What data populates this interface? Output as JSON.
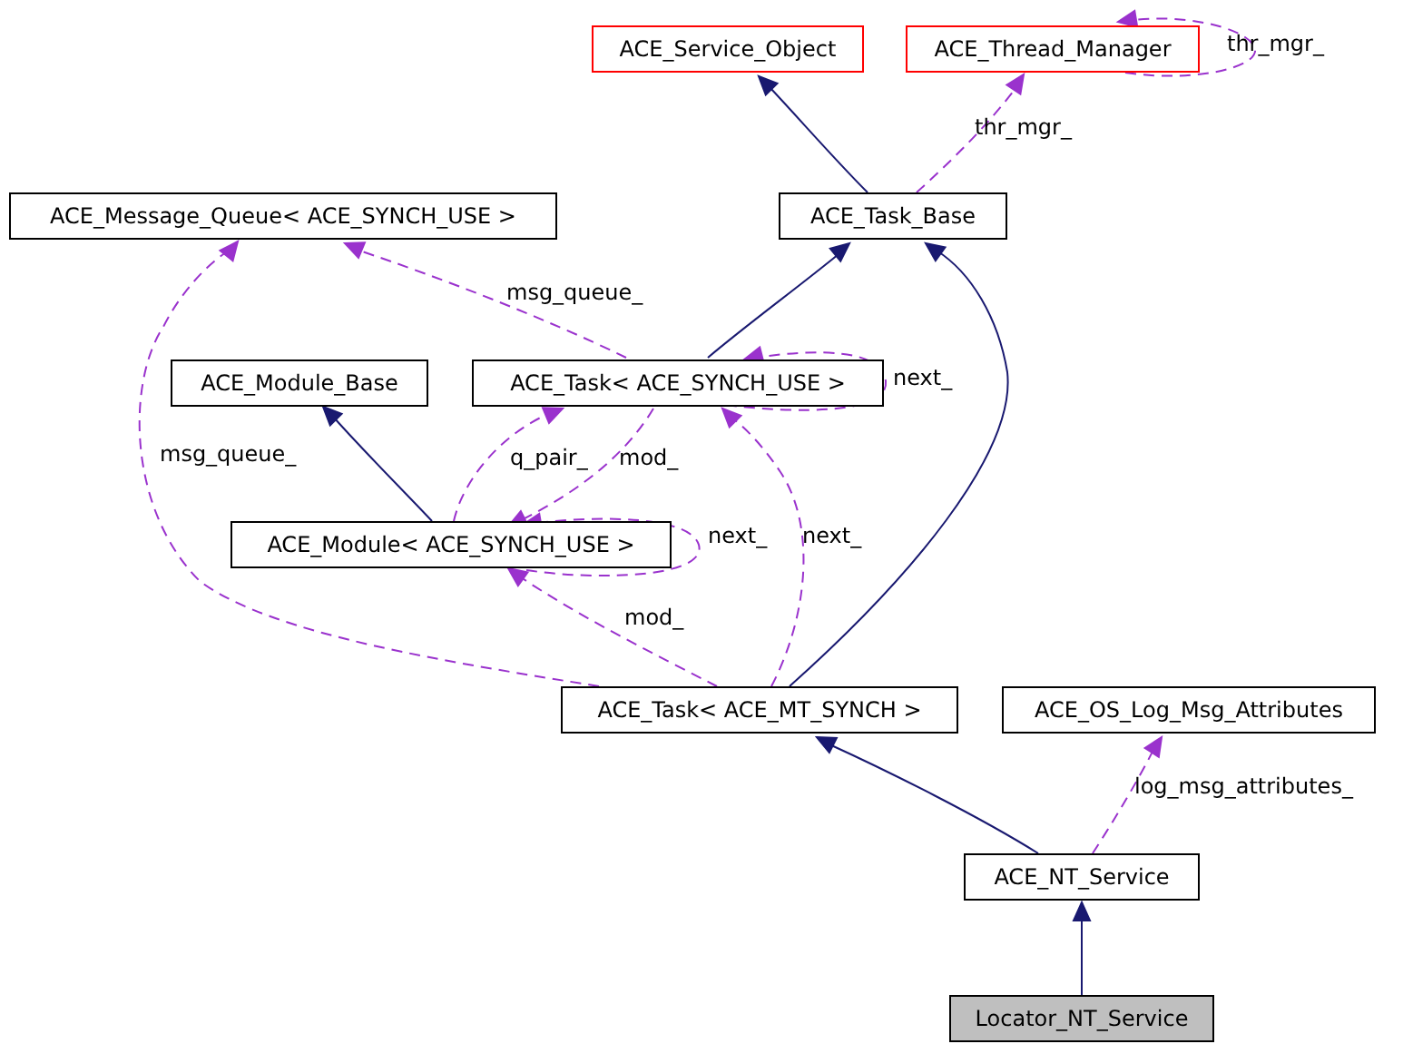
{
  "nodes": [
    {
      "label": "ACE_Service_Object",
      "kind": "external"
    },
    {
      "label": "ACE_Thread_Manager",
      "kind": "external"
    },
    {
      "label": "ACE_Message_Queue< ACE_SYNCH_USE >",
      "kind": "class"
    },
    {
      "label": "ACE_Task_Base",
      "kind": "class"
    },
    {
      "label": "ACE_Module_Base",
      "kind": "class"
    },
    {
      "label": "ACE_Task< ACE_SYNCH_USE >",
      "kind": "class"
    },
    {
      "label": "ACE_Module< ACE_SYNCH_USE >",
      "kind": "class"
    },
    {
      "label": "ACE_Task< ACE_MT_SYNCH >",
      "kind": "class"
    },
    {
      "label": "ACE_OS_Log_Msg_Attributes",
      "kind": "class"
    },
    {
      "label": "ACE_NT_Service",
      "kind": "class"
    },
    {
      "label": "Locator_NT_Service",
      "kind": "focus"
    }
  ],
  "edges": [
    {
      "kind": "inherit"
    },
    {
      "kind": "use",
      "label": "thr_mgr_"
    },
    {
      "kind": "use",
      "label": "thr_mgr_"
    },
    {
      "kind": "inherit"
    },
    {
      "kind": "use",
      "label": "msg_queue_"
    },
    {
      "kind": "use",
      "label": "next_"
    },
    {
      "kind": "inherit"
    },
    {
      "kind": "use",
      "label": "q_pair_"
    },
    {
      "kind": "use",
      "label": "mod_"
    },
    {
      "kind": "use",
      "label": "next_"
    },
    {
      "kind": "inherit"
    },
    {
      "kind": "use",
      "label": "msg_queue_"
    },
    {
      "kind": "use",
      "label": "mod_"
    },
    {
      "kind": "use",
      "label": "next_"
    },
    {
      "kind": "inherit"
    },
    {
      "kind": "use",
      "label": "log_msg_attributes_"
    },
    {
      "kind": "inherit"
    }
  ]
}
